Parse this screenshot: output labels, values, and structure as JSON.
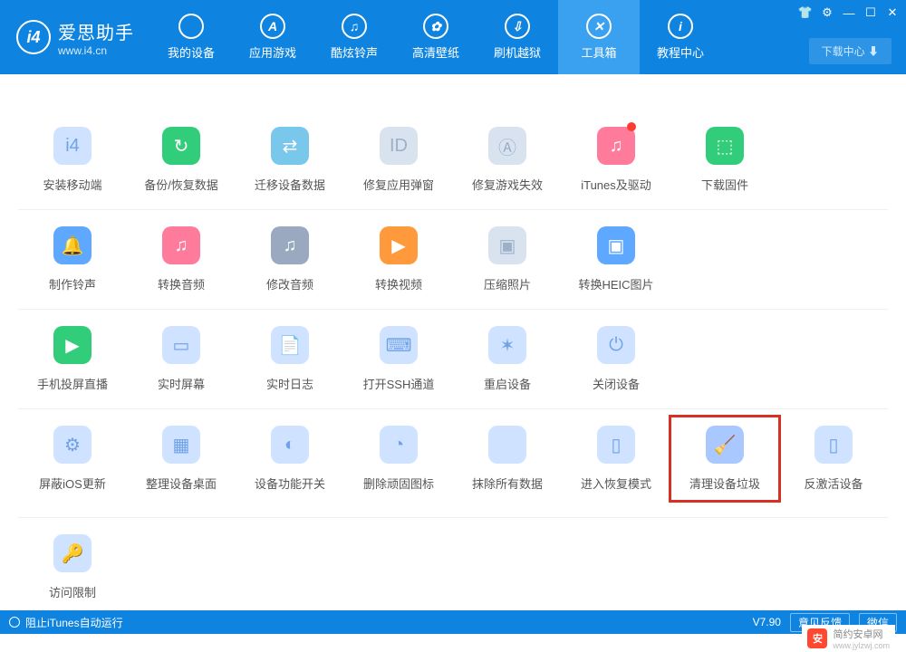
{
  "app": {
    "title_cn": "爱思助手",
    "title_en": "www.i4.cn",
    "logo_letter": "i4"
  },
  "window_controls": {
    "shirt": "👕",
    "gear": "⚙",
    "min": "—",
    "max": "☐",
    "close": "✕"
  },
  "download_center": "下载中心 ⬇",
  "nav": [
    {
      "label": "我的设备",
      "glyph": ""
    },
    {
      "label": "应用游戏",
      "glyph": "A"
    },
    {
      "label": "酷炫铃声",
      "glyph": "♫"
    },
    {
      "label": "高清壁纸",
      "glyph": "✿"
    },
    {
      "label": "刷机越狱",
      "glyph": "⇩"
    },
    {
      "label": "工具箱",
      "glyph": "✕",
      "active": true
    },
    {
      "label": "教程中心",
      "glyph": "i"
    }
  ],
  "rows": [
    [
      {
        "label": "安装移动端",
        "color": "c-lblue",
        "glyph": "i4"
      },
      {
        "label": "备份/恢复数据",
        "color": "c-green",
        "glyph": "↻"
      },
      {
        "label": "迁移设备数据",
        "color": "c-cyan",
        "glyph": "⇄"
      },
      {
        "label": "修复应用弹窗",
        "color": "c-gray",
        "glyph": "ID"
      },
      {
        "label": "修复游戏失效",
        "color": "c-gray",
        "glyph": "Ⓐ"
      },
      {
        "label": "iTunes及驱动",
        "color": "c-pink",
        "glyph": "♫",
        "badge": true
      },
      {
        "label": "下载固件",
        "color": "c-green",
        "glyph": "⬚"
      }
    ],
    [
      {
        "label": "制作铃声",
        "color": "c-blue",
        "glyph": "🔔"
      },
      {
        "label": "转换音频",
        "color": "c-pink",
        "glyph": "♫"
      },
      {
        "label": "修改音频",
        "color": "c-dark",
        "glyph": "♫"
      },
      {
        "label": "转换视频",
        "color": "c-orange",
        "glyph": "▶"
      },
      {
        "label": "压缩照片",
        "color": "c-gray",
        "glyph": "▣"
      },
      {
        "label": "转换HEIC图片",
        "color": "c-blue",
        "glyph": "▣"
      }
    ],
    [
      {
        "label": "手机投屏直播",
        "color": "c-green",
        "glyph": "▶"
      },
      {
        "label": "实时屏幕",
        "color": "c-lblue",
        "glyph": "▭"
      },
      {
        "label": "实时日志",
        "color": "c-lblue",
        "glyph": "📄"
      },
      {
        "label": "打开SSH通道",
        "color": "c-lblue",
        "glyph": "⌨"
      },
      {
        "label": "重启设备",
        "color": "c-lblue",
        "glyph": "✶"
      },
      {
        "label": "关闭设备",
        "color": "c-lblue",
        "glyph": "⏻"
      }
    ],
    [
      {
        "label": "屏蔽iOS更新",
        "color": "c-lblue",
        "glyph": "⚙"
      },
      {
        "label": "整理设备桌面",
        "color": "c-lblue",
        "glyph": "▦"
      },
      {
        "label": "设备功能开关",
        "color": "c-lblue",
        "glyph": "◐"
      },
      {
        "label": "删除顽固图标",
        "color": "c-lblue",
        "glyph": "◔"
      },
      {
        "label": "抹除所有数据",
        "color": "c-lblue",
        "glyph": ""
      },
      {
        "label": "进入恢复模式",
        "color": "c-lblue",
        "glyph": "▯"
      },
      {
        "label": "清理设备垃圾",
        "color": "c-soft",
        "glyph": "🧹",
        "highlight": true
      },
      {
        "label": "反激活设备",
        "color": "c-lblue",
        "glyph": "▯"
      }
    ],
    [
      {
        "label": "访问限制",
        "color": "c-lblue",
        "glyph": "🔑"
      }
    ]
  ],
  "status": {
    "left": "阻止iTunes自动运行",
    "version": "V7.90",
    "feedback": "意见反馈",
    "wechat": "微信"
  },
  "watermark": {
    "brand": "简约安卓网",
    "url": "www.jylzwj.com"
  }
}
